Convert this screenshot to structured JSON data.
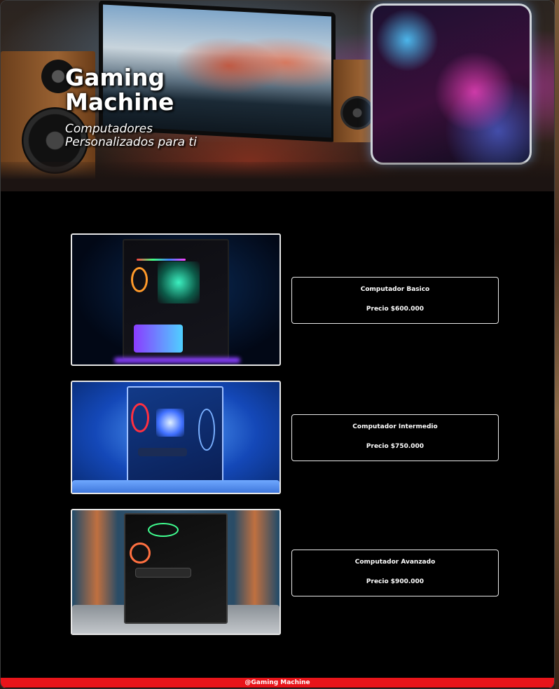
{
  "hero": {
    "title": "Gaming Machine",
    "subtitle": "Computadores Personalizados para ti"
  },
  "products": [
    {
      "name": "Computador Basico",
      "price": "Precio $600.000"
    },
    {
      "name": "Computador Intermedio",
      "price": "Precio $750.000"
    },
    {
      "name": "Computador Avanzado",
      "price": "Precio $900.000"
    }
  ],
  "footer": {
    "text": "@Gaming Machine"
  },
  "colors": {
    "page_background": "#000000",
    "footer_background": "#e8141a",
    "text": "#ffffff",
    "border": "#e8e8e8"
  }
}
